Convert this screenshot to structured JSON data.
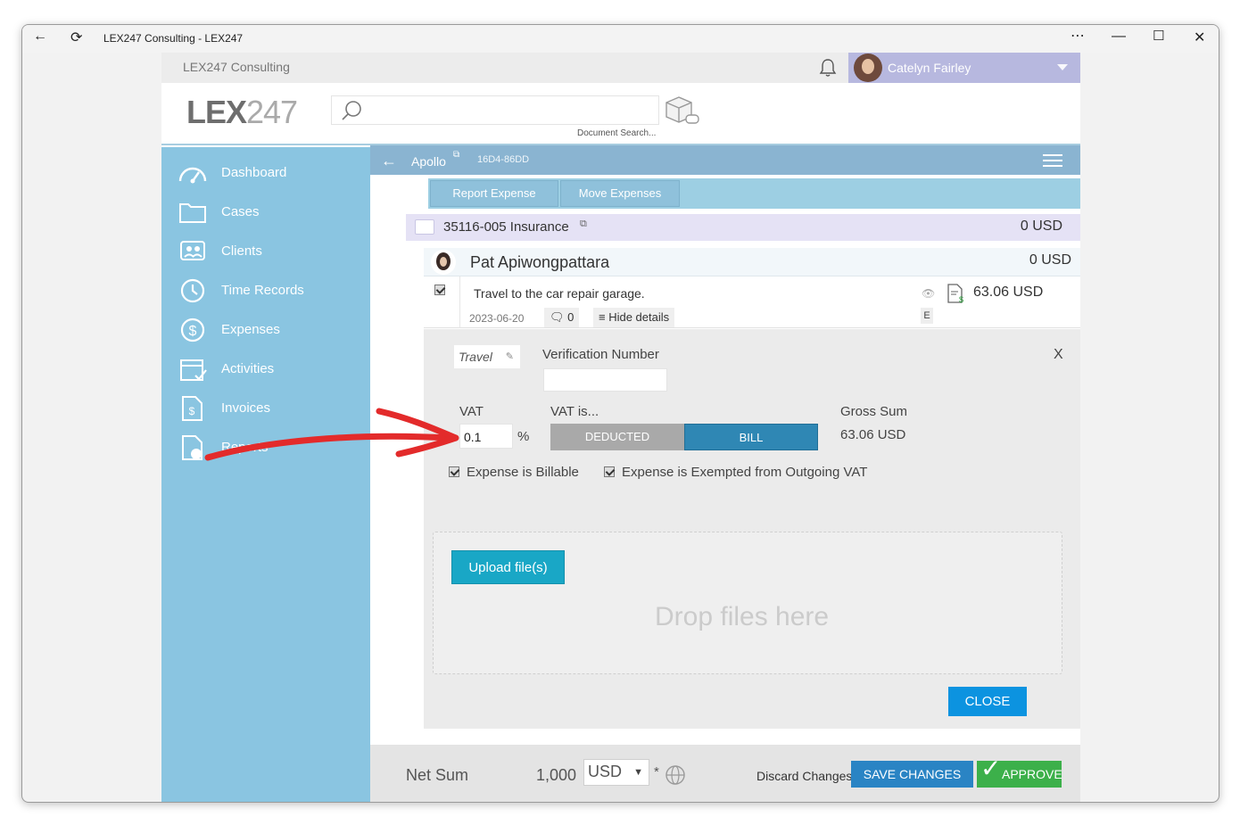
{
  "window": {
    "title": "LEX247 Consulting - LEX247"
  },
  "topbar": {
    "org": "LEX247 Consulting",
    "user": "Catelyn Fairley"
  },
  "header": {
    "logo_bold": "LEX",
    "logo_thin": "247",
    "search_hint": "Document Search..."
  },
  "sidebar": {
    "items": [
      {
        "label": "Dashboard",
        "icon": "dashboard-icon"
      },
      {
        "label": "Cases",
        "icon": "folder-icon"
      },
      {
        "label": "Clients",
        "icon": "clients-icon"
      },
      {
        "label": "Time Records",
        "icon": "clock-icon"
      },
      {
        "label": "Expenses",
        "icon": "dollar-icon"
      },
      {
        "label": "Activities",
        "icon": "calendar-icon"
      },
      {
        "label": "Invoices",
        "icon": "invoice-icon"
      },
      {
        "label": "Reports",
        "icon": "report-icon"
      }
    ]
  },
  "case": {
    "name": "Apollo",
    "id": "16D4-86DD"
  },
  "actions": {
    "report_expense": "Report Expense",
    "move_expenses": "Move Expenses"
  },
  "matter": {
    "title": "35116-005 Insurance",
    "amount": "0 USD"
  },
  "person": {
    "name": "Pat Apiwongpattara",
    "amount": "0 USD"
  },
  "expense": {
    "description": "Travel to the car repair garage.",
    "date": "2023-06-20",
    "comments": "0",
    "hide_details": "Hide details",
    "amount": "63.06 USD",
    "badge": "E"
  },
  "details": {
    "category": "Travel",
    "verification_label": "Verification Number",
    "verification_value": "",
    "close_x": "X",
    "vat_label": "VAT",
    "vat_value": "0.1",
    "vat_unit": "%",
    "vat_is_label": "VAT is...",
    "deducted": "DEDUCTED",
    "bill": "BILL",
    "gross_label": "Gross Sum",
    "gross_value": "63.06 USD",
    "billable": "Expense is Billable",
    "exempted": "Expense is Exempted from Outgoing VAT",
    "upload": "Upload file(s)",
    "drop": "Drop files here",
    "close": "CLOSE"
  },
  "footer": {
    "net_label": "Net Sum",
    "net_value": "1,000",
    "currency": "USD",
    "star": "*",
    "discard": "Discard Changes",
    "save": "SAVE CHANGES",
    "approve": "APPROVE"
  },
  "colors": {
    "sidebar": "#8ac5e1",
    "casebar": "#8ab4d1",
    "bill_active": "#2f87b4",
    "deducted": "#a9a9a9",
    "close": "#0c93e0",
    "approve": "#3cb04a",
    "annotation_arrow": "#e32b2b"
  }
}
